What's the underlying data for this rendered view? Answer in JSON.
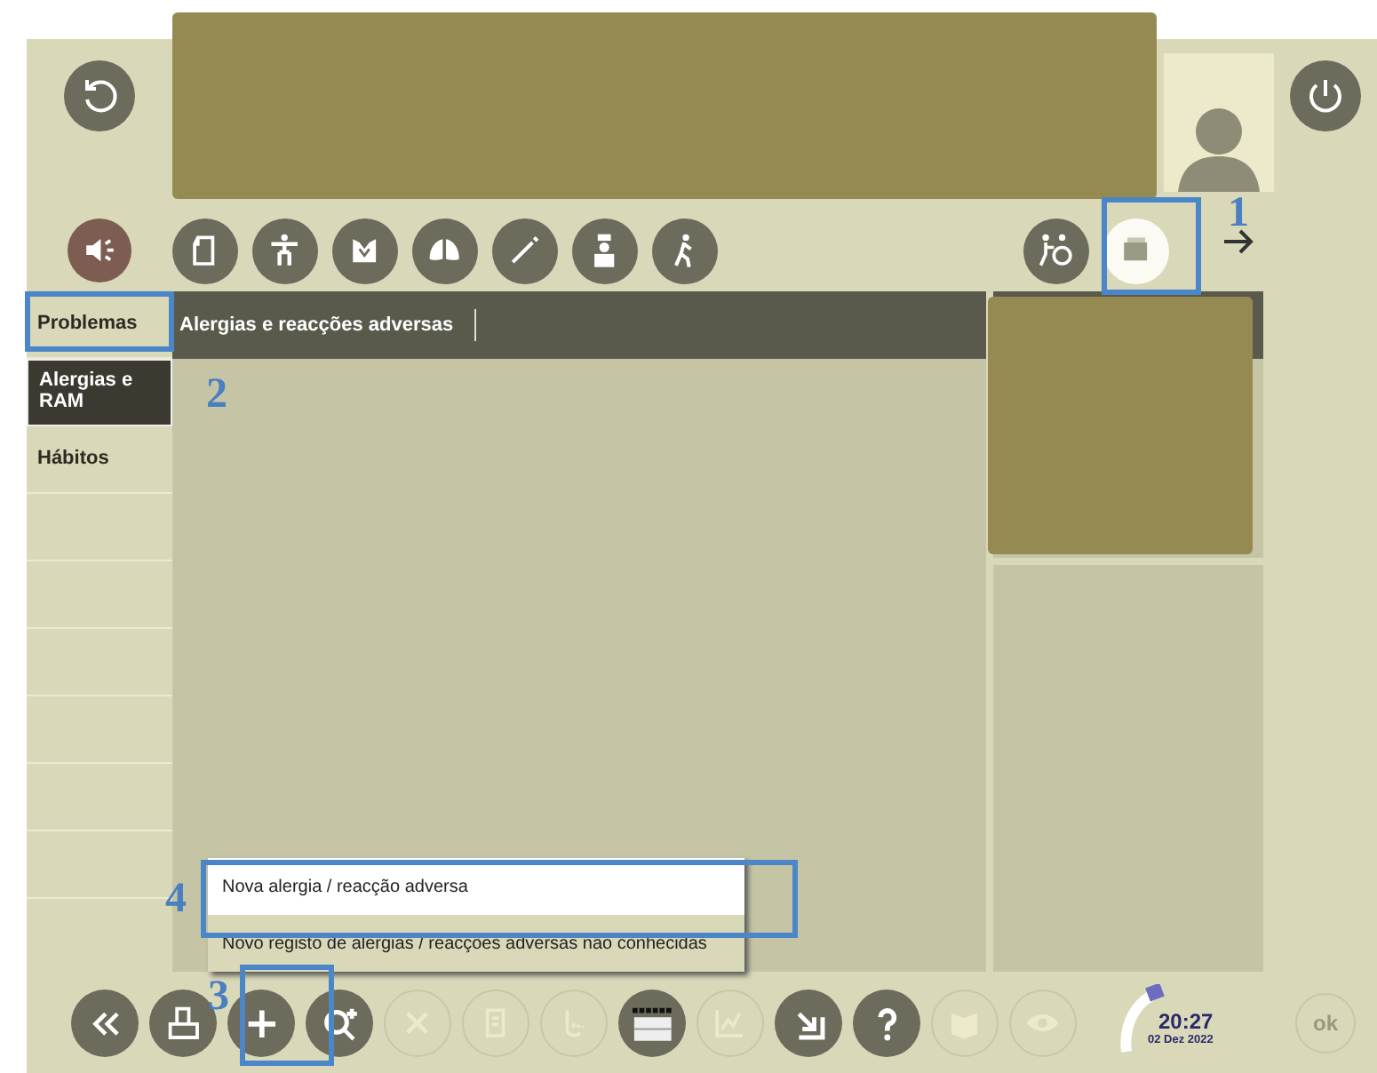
{
  "top_icons": [
    {
      "kind": "document",
      "selected": false
    },
    {
      "kind": "body",
      "selected": false
    },
    {
      "kind": "torso",
      "selected": false
    },
    {
      "kind": "lungs",
      "selected": false
    },
    {
      "kind": "syringe",
      "selected": false
    },
    {
      "kind": "nurse",
      "selected": false
    },
    {
      "kind": "walker",
      "selected": false
    },
    {
      "kind": "wheelchair",
      "selected": false
    },
    {
      "kind": "records",
      "selected": true
    }
  ],
  "sidebar": {
    "items": [
      {
        "label": "Problemas",
        "selected": false
      },
      {
        "label": "Alergias e RAM",
        "selected": true
      },
      {
        "label": "Hábitos",
        "selected": false
      }
    ]
  },
  "header": {
    "title": "Alergias e reacções adversas"
  },
  "popup": {
    "items": [
      {
        "label": "Nova alergia / reacção adversa",
        "selected": true
      },
      {
        "label": "Novo registo de alergias / reacções adversas não conhecidas",
        "selected": false
      }
    ]
  },
  "toolbar": [
    {
      "kind": "back",
      "disabled": false
    },
    {
      "kind": "print",
      "disabled": false
    },
    {
      "kind": "add",
      "disabled": false
    },
    {
      "kind": "zoom",
      "disabled": false
    },
    {
      "kind": "delete",
      "disabled": true
    },
    {
      "kind": "copy",
      "disabled": true
    },
    {
      "kind": "touch",
      "disabled": true
    },
    {
      "kind": "dashes",
      "disabled": false
    },
    {
      "kind": "chart",
      "disabled": true
    },
    {
      "kind": "export",
      "disabled": false
    },
    {
      "kind": "help",
      "disabled": false
    },
    {
      "kind": "book",
      "disabled": true
    },
    {
      "kind": "eye",
      "disabled": true
    }
  ],
  "clock": {
    "time": "20:27",
    "date": "02 Dez 2022"
  },
  "ok_button": {
    "label": "ok",
    "disabled": true
  },
  "annotations": [
    {
      "number": "1"
    },
    {
      "number": "2"
    },
    {
      "number": "3"
    },
    {
      "number": "4"
    }
  ]
}
